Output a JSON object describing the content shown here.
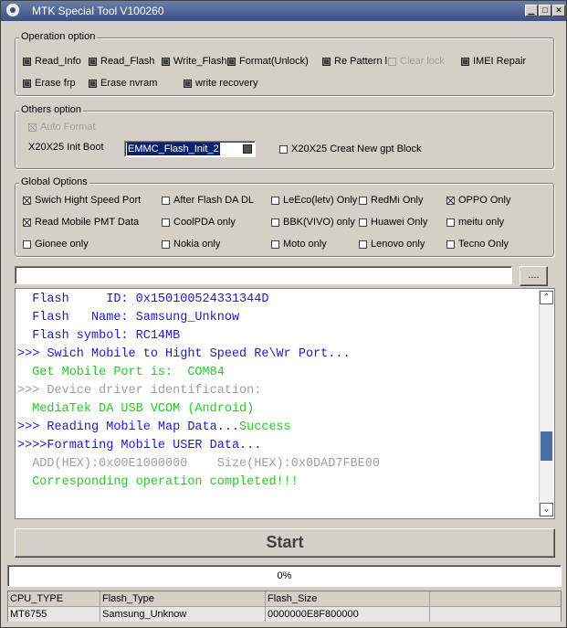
{
  "window": {
    "title": "MTK Special Tool V100260"
  },
  "operation_option": {
    "legend": "Operation option",
    "items": [
      {
        "label": "Read_Info",
        "checked": false
      },
      {
        "label": "Read_Flash",
        "checked": false
      },
      {
        "label": "Write_Flash",
        "checked": false
      },
      {
        "label": "Format(Unlock)",
        "checked": false
      },
      {
        "label": "Re Pattern l",
        "checked": false
      },
      {
        "label": "Clear lock",
        "checked": false,
        "disabled": true
      },
      {
        "label": "IMEI Repair",
        "checked": false
      },
      {
        "label": "Erase frp",
        "checked": false
      },
      {
        "label": "Erase nvram",
        "checked": false
      },
      {
        "label": "write recovery",
        "checked": false
      }
    ]
  },
  "others_option": {
    "legend": "Others option",
    "auto_format": {
      "label": "Auto Format",
      "checked": true,
      "disabled": true
    },
    "init_boot_label": "X20X25 Init Boot",
    "init_boot_value": "EMMC_Flash_Init_2",
    "gpt": {
      "label": "X20X25 Creat New gpt Block",
      "checked": false
    }
  },
  "global_options": {
    "legend": "Global Options",
    "items": [
      {
        "label": "Swich Hight Speed Port",
        "checked": true
      },
      {
        "label": "After Flash DA DL",
        "checked": false
      },
      {
        "label": "LeEco(letv) Only",
        "checked": false
      },
      {
        "label": "RedMi Only",
        "checked": false
      },
      {
        "label": "OPPO Only",
        "checked": true
      },
      {
        "label": "Read Mobile PMT Data",
        "checked": true
      },
      {
        "label": "CoolPDA only",
        "checked": false
      },
      {
        "label": "BBK(VIVO) only",
        "checked": false
      },
      {
        "label": "Huawei Only",
        "checked": false
      },
      {
        "label": "meitu only",
        "checked": false
      },
      {
        "label": "Gionee only",
        "checked": false
      },
      {
        "label": "Nokia only",
        "checked": false
      },
      {
        "label": "Moto only",
        "checked": false
      },
      {
        "label": "Lenovo only",
        "checked": false
      },
      {
        "label": "Tecno Only",
        "checked": false
      }
    ]
  },
  "path_field": {
    "value": "",
    "browse_label": "...."
  },
  "log": {
    "lines": [
      {
        "parts": [
          {
            "text": "  Flash     ID: 0x150100524331344D",
            "color": "blue"
          }
        ]
      },
      {
        "parts": [
          {
            "text": "  Flash   Name: Samsung_Unknow",
            "color": "blue"
          }
        ]
      },
      {
        "parts": [
          {
            "text": "  Flash symbol: RC14MB",
            "color": "blue"
          }
        ]
      },
      {
        "parts": [
          {
            "text": ">>> Swich Mobile to Hight Speed Re\\Wr Port...",
            "color": "blue"
          }
        ]
      },
      {
        "parts": [
          {
            "text": "  Get Mobile Port is:  COM84",
            "color": "green"
          }
        ]
      },
      {
        "parts": [
          {
            "text": ">>> Device driver identification:",
            "color": "gray"
          }
        ]
      },
      {
        "parts": [
          {
            "text": "  MediaTek DA USB VCOM (Android)",
            "color": "green"
          }
        ]
      },
      {
        "parts": [
          {
            "text": ">>> Reading Mobile Map Data...",
            "color": "blue"
          },
          {
            "text": "Success",
            "color": "green"
          }
        ]
      },
      {
        "parts": [
          {
            "text": ">>>>Formating Mobile USER Data...",
            "color": "blue"
          }
        ]
      },
      {
        "parts": [
          {
            "text": "  ADD(HEX):0x00E1000000    Size(HEX):0x0DAD7FBE00",
            "color": "gray"
          }
        ]
      },
      {
        "parts": [
          {
            "text": "  Corresponding operation completed!!!",
            "color": "green"
          }
        ]
      }
    ]
  },
  "start_button": {
    "label": "Start"
  },
  "progress": {
    "text": "0%",
    "value": 0
  },
  "info_table": {
    "headers": [
      "CPU_TYPE",
      "Flash_Type",
      "Flash_Size",
      ""
    ],
    "row": [
      "MT6755",
      "Samsung_Unknow",
      "0000000E8F800000",
      ""
    ]
  },
  "colors": {
    "blue": "#1a1ad0",
    "green": "#22cc22",
    "gray": "#a0a0a0",
    "title_bar": "#3b5084"
  }
}
